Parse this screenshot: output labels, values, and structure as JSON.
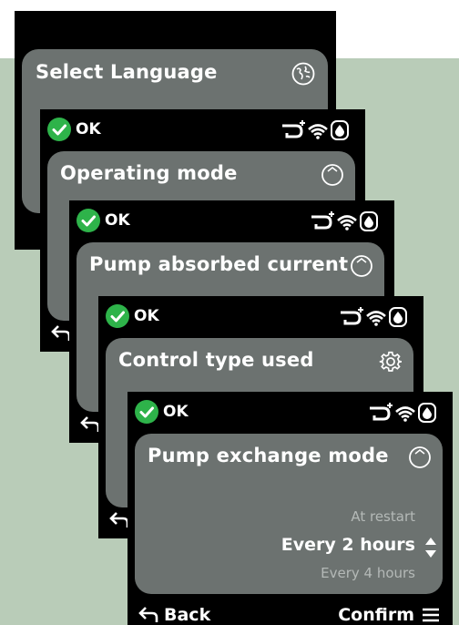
{
  "screens": [
    {
      "title": "Select Language",
      "title_icon": "globe-icon"
    },
    {
      "status": "OK",
      "title": "Operating mode",
      "title_icon": "circle-icon"
    },
    {
      "status": "OK",
      "title": "Pump absorbed current",
      "title_icon": "circle-icon"
    },
    {
      "status": "OK",
      "title": "Control type used",
      "title_icon": "gear-icon"
    },
    {
      "status": "OK",
      "title": "Pump exchange mode",
      "title_icon": "circle-icon",
      "options": {
        "previous": "At restart",
        "selected": "Every 2 hours",
        "next": "Every 4 hours"
      },
      "footer": {
        "back_label": "Back",
        "confirm_label": "Confirm"
      }
    }
  ],
  "status_icons": [
    "pump-plus-icon",
    "wifi-icon",
    "water-drop-icon"
  ],
  "colors": {
    "screen_bg": "#000000",
    "card_bg": "#6c7270",
    "ok_green": "#2eb34a",
    "backdrop": "#b9ccb8"
  }
}
